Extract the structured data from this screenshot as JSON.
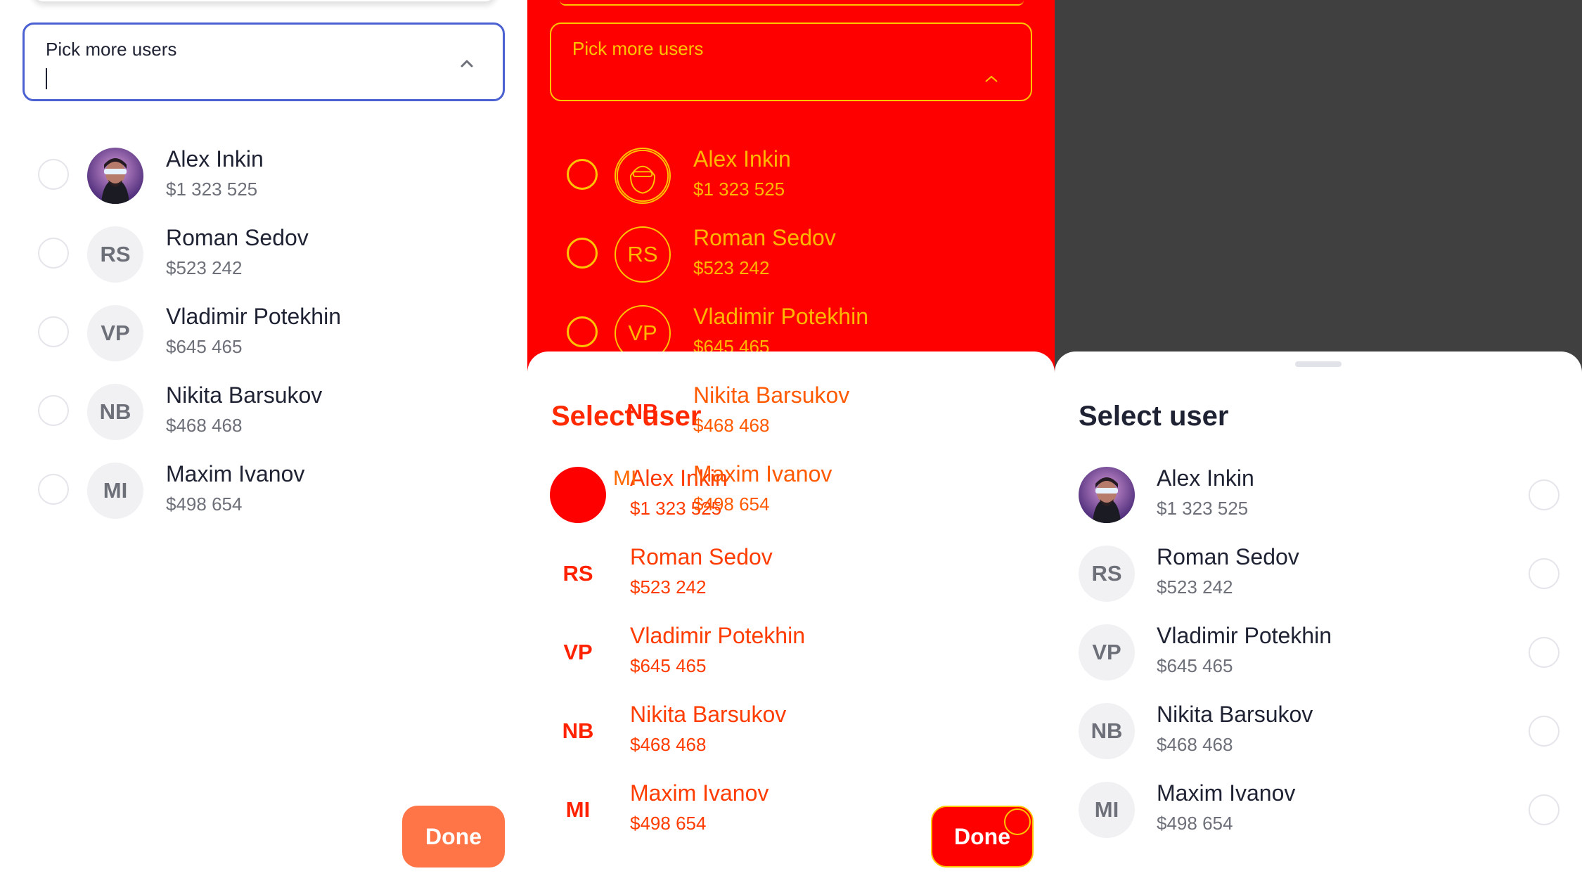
{
  "picker": {
    "label": "Pick more users",
    "value": ""
  },
  "sheet": {
    "title": "Select user"
  },
  "done_label": "Done",
  "users": [
    {
      "name": "Alex Inkin",
      "amount": "$1 323 525",
      "initials": "",
      "photo": true,
      "selected": false
    },
    {
      "name": "Roman Sedov",
      "amount": "$523 242",
      "initials": "RS",
      "photo": false,
      "selected": false
    },
    {
      "name": "Vladimir Potekhin",
      "amount": "$645 465",
      "initials": "VP",
      "photo": false,
      "selected": false
    },
    {
      "name": "Nikita Barsukov",
      "amount": "$468 468",
      "initials": "NB",
      "photo": false,
      "selected": false
    },
    {
      "name": "Maxim Ivanov",
      "amount": "$498 654",
      "initials": "MI",
      "photo": false,
      "selected": false
    }
  ],
  "overflow_initials": "MI",
  "colors": {
    "accent_border": "#4b61d1",
    "done_button": "#ff7547",
    "debug_background": "#ff0000",
    "debug_outline": "#ffc400",
    "scrim": "#404040"
  }
}
